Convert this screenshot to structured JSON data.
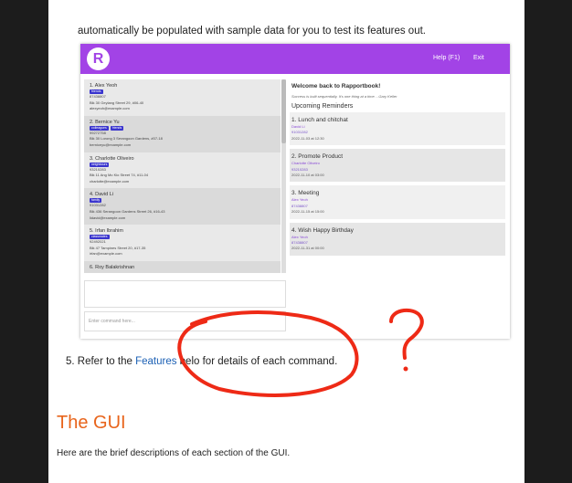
{
  "doc": {
    "intro": "automatically be populated with sample data for you to test its features out.",
    "step5_prefix": "5. Refer to the ",
    "step5_link": "Features",
    "step5_suffix": " belo  for details of each command.",
    "heading": "The GUI",
    "desc": "Here are the brief descriptions of each section of the GUI."
  },
  "app": {
    "logo": "R",
    "menu": {
      "help": "Help (F1)",
      "exit": "Exit"
    },
    "contacts": [
      {
        "name": "1.  Alex Yeoh",
        "tags": [
          "friends"
        ],
        "phone": "87438807",
        "address": "Blk 30 Geylang Street 29, #06-40",
        "email": "alexyeoh@example.com"
      },
      {
        "name": "2.  Bernice Yu",
        "tags": [
          "colleagues",
          "friends"
        ],
        "phone": "99272758",
        "address": "Blk 30 Lorong 3 Serangoon Gardens, #07-18",
        "email": "berniceyu@example.com"
      },
      {
        "name": "3.  Charlotte Oliveiro",
        "tags": [
          "neighbours"
        ],
        "phone": "93210283",
        "address": "Blk 11 Ang Mo Kio Street 74, #11-04",
        "email": "charlotte@example.com"
      },
      {
        "name": "4.  David Li",
        "tags": [
          "family"
        ],
        "phone": "91031282",
        "address": "Blk 436 Serangoon Gardens Street 26, #16-43",
        "email": "lidavid@example.com"
      },
      {
        "name": "5.  Irfan Ibrahim",
        "tags": [
          "classmates"
        ],
        "phone": "92492021",
        "address": "Blk 47 Tampines Street 20, #17-35",
        "email": "irfan@example.com"
      },
      {
        "name": "6.  Roy Balakrishnan",
        "tags": [],
        "phone": "",
        "address": "",
        "email": ""
      }
    ],
    "command_placeholder": "Enter command here...",
    "welcome": "Welcome back to Rapportbook!",
    "quote": "Success is built sequentially. It's one thing at a time. - Gary Keller",
    "upcoming_title": "Upcoming Reminders",
    "reminders": [
      {
        "title": "1. Lunch and chitchat",
        "person": "David Li",
        "phone": "91031282",
        "date": "2022-11-03 at 12:30"
      },
      {
        "title": "2. Promote Product",
        "person": "Charlotte Oliveiro",
        "phone": "93210283",
        "date": "2022-11-10 at 03:00"
      },
      {
        "title": "3. Meeting",
        "person": "Alex Yeoh",
        "phone": "87438807",
        "date": "2022-11-15 at 15:00"
      },
      {
        "title": "4. Wish Happy Birthday",
        "person": "Alex Yeoh",
        "phone": "87438807",
        "date": "2022-11-31 at 00:00"
      }
    ]
  },
  "annotation": {
    "text": "?",
    "color": "#ee2a16"
  },
  "colors": {
    "app_bar": "#a243e6",
    "tag": "#3a35ce",
    "heading": "#e8641b",
    "link": "#1a5fb4"
  }
}
